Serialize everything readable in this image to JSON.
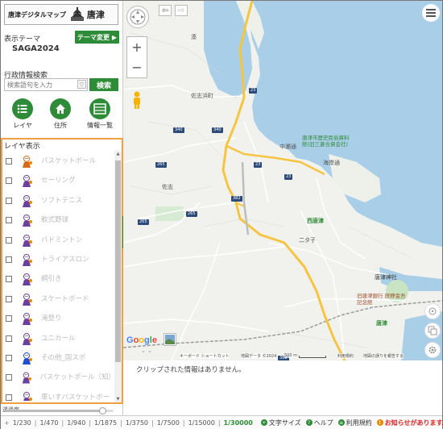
{
  "header": {
    "logo_text": "唐津デジタルマップ",
    "logo_kanji": "唐津",
    "theme_label": "表示テーマ",
    "theme_value": "SAGA2024",
    "theme_button": "テーマ変更 ▶"
  },
  "search": {
    "label": "行政情報検索",
    "placeholder": "検索語句を入力",
    "button": "検索"
  },
  "quick_buttons": [
    {
      "label": "レイヤ",
      "icon": "list-icon"
    },
    {
      "label": "住所",
      "icon": "home-icon"
    },
    {
      "label": "情報一覧",
      "icon": "table-icon"
    }
  ],
  "layers": {
    "title": "レイヤ表示",
    "items": [
      {
        "label": "バスケットボール",
        "icon": "basketball-icon"
      },
      {
        "label": "セーリング",
        "icon": "sailing-icon"
      },
      {
        "label": "ソフトテニス",
        "icon": "soft-tennis-icon"
      },
      {
        "label": "軟式野球",
        "icon": "baseball-icon"
      },
      {
        "label": "バドミントン",
        "icon": "badminton-icon"
      },
      {
        "label": "トライアスロン",
        "icon": "triathlon-icon"
      },
      {
        "label": "綱引き",
        "icon": "tug-of-war-icon"
      },
      {
        "label": "スケートボード",
        "icon": "skateboard-icon"
      },
      {
        "label": "滝登り",
        "icon": "climbing-icon"
      },
      {
        "label": "ユニカール",
        "icon": "unicurl-icon"
      },
      {
        "label": "その他_国スポ",
        "icon": "balloon-icon"
      },
      {
        "label": "バスケットボール（知）",
        "icon": "basketball-icon"
      },
      {
        "label": "車いすバスケットボー",
        "icon": "wheelchair-basketball-icon"
      }
    ]
  },
  "transparency": {
    "label": "透過度",
    "value": 0.9
  },
  "map": {
    "labels": {
      "saga_shi": "佐志",
      "saga_hamacho": "佐志浜町",
      "nakamachi": "中瀬通",
      "kaigan": "海岸通",
      "nishi_karatsu": "西唐津",
      "nishino": "二タ子",
      "karatsu_jinja": "唐津神社",
      "museum": "唐津市歴史民俗資料館(旧三菱合資会社)",
      "bank": "旧唐津銀行 辰野金吾記念館",
      "karatsu_st": "唐津",
      "minato": "湊",
      "saga_small": "佐志"
    },
    "road_numbers": [
      "23",
      "340",
      "265",
      "382",
      "265",
      "382",
      "23",
      "23",
      "340",
      "265"
    ],
    "attribution": {
      "shortcut": "キーボード ショートカット",
      "data": "地図データ ©2024",
      "scale": "500 m",
      "terms": "利用規約",
      "report": "地図の誤りを報告する"
    },
    "google_logo": "Google"
  },
  "info": {
    "message": "クリップされた情報はありません。"
  },
  "bottom": {
    "scales": [
      "1/230",
      "1/470",
      "1/940",
      "1/1875",
      "1/3750",
      "1/7500",
      "1/15000",
      "1/30000"
    ],
    "active_scale": "1/30000",
    "links": [
      {
        "label": "文字サイズ",
        "icon": "plus-icon"
      },
      {
        "label": "ヘルプ",
        "icon": "question-icon"
      },
      {
        "label": "利用規約",
        "icon": "doc-icon"
      },
      {
        "label": "お知らせがあります。",
        "icon": "alert-icon"
      }
    ]
  },
  "colors": {
    "accent": "#2e8b37",
    "sea": "#a9cfe8",
    "highlight_border": "#f0a040",
    "road_yellow": "#f5c542",
    "alert": "#d22222"
  }
}
